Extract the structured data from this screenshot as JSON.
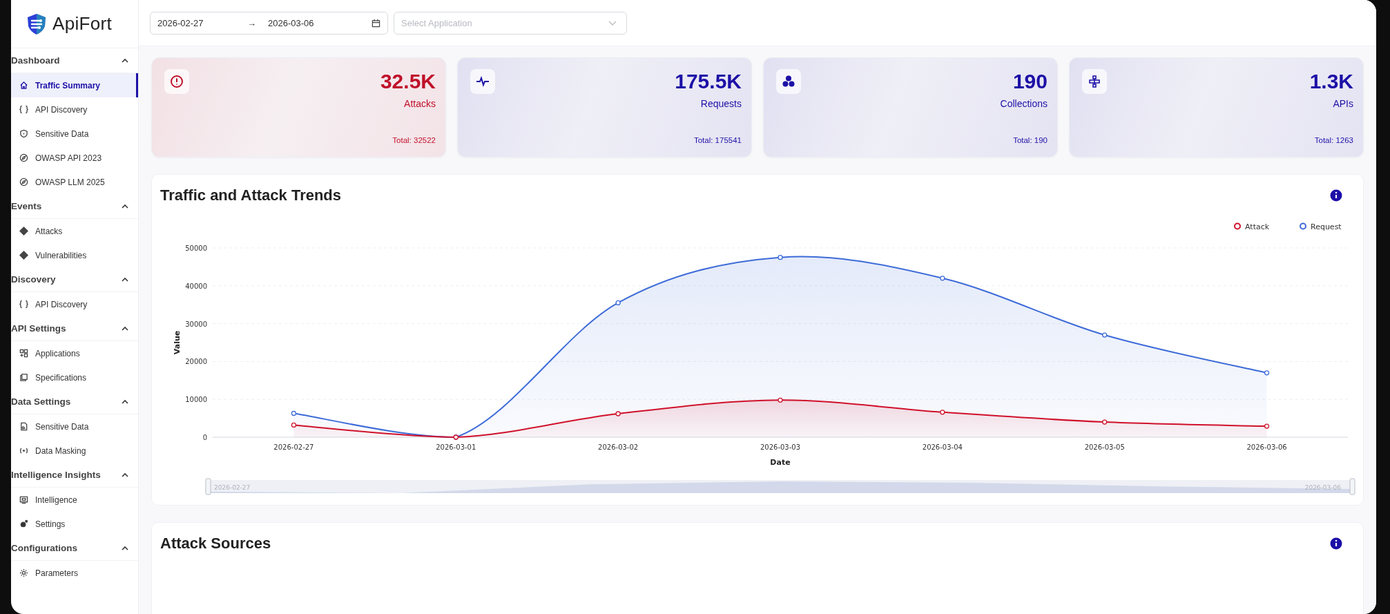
{
  "sidebar": {
    "logo": "ApiFort",
    "sections": [
      {
        "title": "Dashboard",
        "expanded": true,
        "items": [
          {
            "label": "Traffic Summary",
            "selected": true
          },
          {
            "label": "API Discovery",
            "selected": false
          },
          {
            "label": "Sensitive Data",
            "selected": false
          },
          {
            "label": "OWASP API 2023",
            "selected": false
          },
          {
            "label": "OWASP LLM 2025",
            "selected": false
          }
        ]
      },
      {
        "title": "Events",
        "expanded": true,
        "items": [
          {
            "label": "Attacks",
            "selected": false
          },
          {
            "label": "Vulnerabilities",
            "selected": false
          }
        ]
      },
      {
        "title": "Discovery",
        "expanded": true,
        "items": [
          {
            "label": "API Discovery",
            "selected": false
          }
        ]
      },
      {
        "title": "API Settings",
        "expanded": true,
        "items": [
          {
            "label": "Applications",
            "selected": false
          },
          {
            "label": "Specifications",
            "selected": false
          }
        ]
      },
      {
        "title": "Data Settings",
        "expanded": true,
        "items": [
          {
            "label": "Sensitive Data",
            "selected": false
          },
          {
            "label": "Data Masking",
            "selected": false
          }
        ]
      },
      {
        "title": "Intelligence Insights",
        "expanded": true,
        "items": [
          {
            "label": "Intelligence",
            "selected": false
          },
          {
            "label": "Settings",
            "selected": false
          }
        ]
      },
      {
        "title": "Configurations",
        "expanded": true,
        "items": [
          {
            "label": "Parameters",
            "selected": false
          }
        ]
      }
    ]
  },
  "toolbar": {
    "date_start": "2026-02-27",
    "date_separator": "→",
    "date_end": "2026-03-06",
    "application_select": {
      "placeholder": "Select Application"
    }
  },
  "cards": [
    {
      "value": "32.5K",
      "label": "Attacks",
      "total": "Total: 32522",
      "color": "#c0102a"
    },
    {
      "value": "175.5K",
      "label": "Requests",
      "total": "Total: 175541",
      "color": "#1c0fa6"
    },
    {
      "value": "190",
      "label": "Collections",
      "total": "Total: 190",
      "color": "#1c0fa6"
    },
    {
      "value": "1.3K",
      "label": "APIs",
      "total": "Total: 1263",
      "color": "#1c0fa6"
    }
  ],
  "trend_panel": {
    "title": "Traffic and Attack Trends",
    "chart_data": {
      "type": "area",
      "xlabel": "Date",
      "ylabel": "Value",
      "categories": [
        "2026-02-27",
        "2026-03-01",
        "2026-03-02",
        "2026-03-03",
        "2026-03-04",
        "2026-03-05",
        "2026-03-06"
      ],
      "series": [
        {
          "name": "Attack",
          "color": "#d0112b",
          "values": [
            3200,
            0,
            6200,
            9800,
            6600,
            4000,
            2900
          ]
        },
        {
          "name": "Request",
          "color": "#3d6bd8",
          "values": [
            6300,
            0,
            35500,
            47500,
            42000,
            27000,
            17000
          ]
        }
      ],
      "ylim": [
        0,
        50000
      ],
      "yticks": [
        0,
        10000,
        20000,
        30000,
        40000,
        50000
      ],
      "grid": true,
      "legend": true
    },
    "slider": {
      "start_label": "2026-02-27",
      "end_label": "2026-03-06"
    }
  },
  "sources_panel": {
    "title": "Attack Sources"
  }
}
